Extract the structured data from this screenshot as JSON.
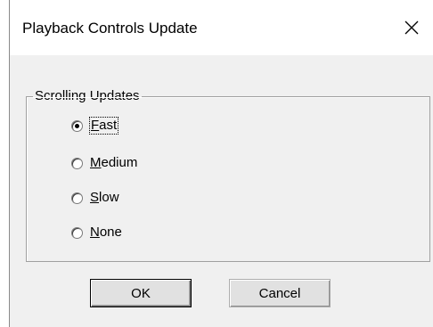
{
  "window": {
    "title": "Playback Controls Update",
    "close_icon": "close-icon"
  },
  "group": {
    "legend": "Scrolling Updates",
    "options": [
      {
        "mnemonic": "F",
        "rest": "ast",
        "selected": true
      },
      {
        "mnemonic": "M",
        "rest": "edium",
        "selected": false
      },
      {
        "mnemonic": "S",
        "rest": "low",
        "selected": false
      },
      {
        "mnemonic": "N",
        "rest": "one",
        "selected": false
      }
    ]
  },
  "buttons": {
    "ok_label": "OK",
    "cancel_label": "Cancel"
  }
}
